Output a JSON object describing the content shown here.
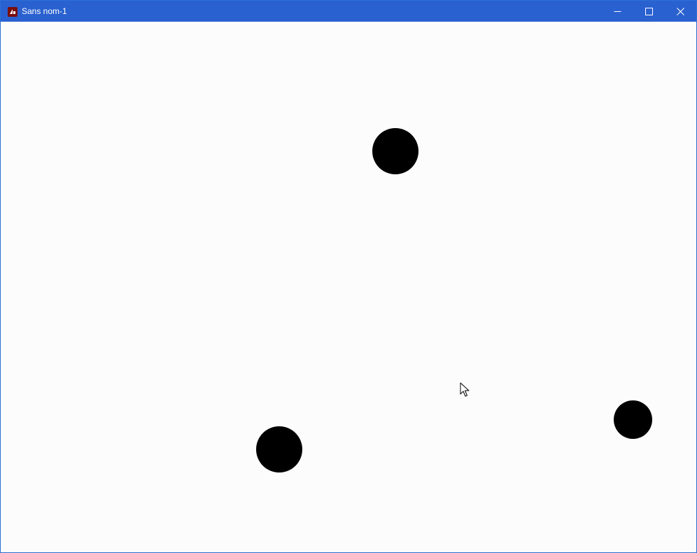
{
  "window": {
    "title": "Sans nom-1",
    "accent_color": "#2a61d0",
    "icons": {
      "app": "processing-app-icon",
      "minimize": "minimize-icon",
      "maximize": "maximize-icon",
      "close": "close-icon"
    }
  },
  "canvas": {
    "background": "#fcfcfc",
    "ball_color": "#000000",
    "ball_count": 3
  }
}
